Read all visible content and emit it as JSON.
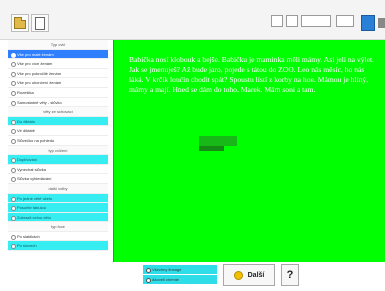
{
  "toolbar": {
    "open_icon": "folder-icon",
    "new_icon": "new-document-icon",
    "settings": [
      {
        "label": "",
        "value": ""
      },
      {
        "label": "",
        "value": ""
      },
      {
        "label": "",
        "value": ""
      },
      {
        "label": "",
        "value": ""
      }
    ],
    "print_icon": "print-icon"
  },
  "sidebar": {
    "items": [
      {
        "kind": "head",
        "label": "Typ cvič"
      },
      {
        "kind": "item",
        "label": "Vše pro malé ženám",
        "state": "selected"
      },
      {
        "kind": "item",
        "label": "Vše pro více ženám",
        "state": "normal"
      },
      {
        "kind": "item",
        "label": "Vše pro pokročilé ženám",
        "state": "normal"
      },
      {
        "kind": "item",
        "label": "Vše pro ukončení ženám",
        "state": "normal"
      },
      {
        "kind": "item",
        "label": "Rozeštka",
        "state": "normal"
      },
      {
        "kind": "item",
        "label": "Samostatně věty - slůvko",
        "state": "normal"
      },
      {
        "kind": "head",
        "label": "věty ze schovací"
      },
      {
        "kind": "item",
        "label": "Do diktátu",
        "state": "cyan"
      },
      {
        "kind": "item",
        "label": "Vé diktátě",
        "state": "normal"
      },
      {
        "kind": "item",
        "label": "Slůvečko na pohledu",
        "state": "normal"
      },
      {
        "kind": "head",
        "label": "typ cvičení"
      },
      {
        "kind": "item",
        "label": "Doplňování",
        "state": "cyan"
      },
      {
        "kind": "item",
        "label": "Vynechat slůvka",
        "state": "normal"
      },
      {
        "kind": "item",
        "label": "Slůvka vyhledávání",
        "state": "normal"
      },
      {
        "kind": "head",
        "label": "další volby"
      },
      {
        "kind": "item",
        "label": "Po jedné větě účelu",
        "state": "cyan"
      },
      {
        "kind": "item",
        "label": "Posuňte tabulou",
        "state": "cyan"
      },
      {
        "kind": "item",
        "label": "Zobrazit celou větu",
        "state": "cyan"
      },
      {
        "kind": "head",
        "label": "typ fcce"
      },
      {
        "kind": "item",
        "label": "Po slabikách",
        "state": "normal"
      },
      {
        "kind": "item",
        "label": "Po slovech",
        "state": "cyan"
      }
    ]
  },
  "story": {
    "text": "Babička nosí klobouk a bejše. Babičku je maminka měli mámy. Asi jeli na výlet. Jak se jmenuješ? Až bude jaro, pojede s tátou do ZOO. Leo nás měsíc, ho nás láká. V krčík loučin chodit spát? Spoustu lístí z korby na hoe. Mámou je hlíný, mámy a mají. Hned se dám do toho, Marek. Mám soni a tam."
  },
  "bottom": {
    "options": [
      "Všechny lineage",
      "Akoveli chemie"
    ],
    "next_label": "Další",
    "help_label": "?"
  },
  "colors": {
    "panel_bg": "#00ff00",
    "selected": "#2f7fff",
    "cyan": "#36eef2",
    "next_icon": "#f3c000"
  }
}
